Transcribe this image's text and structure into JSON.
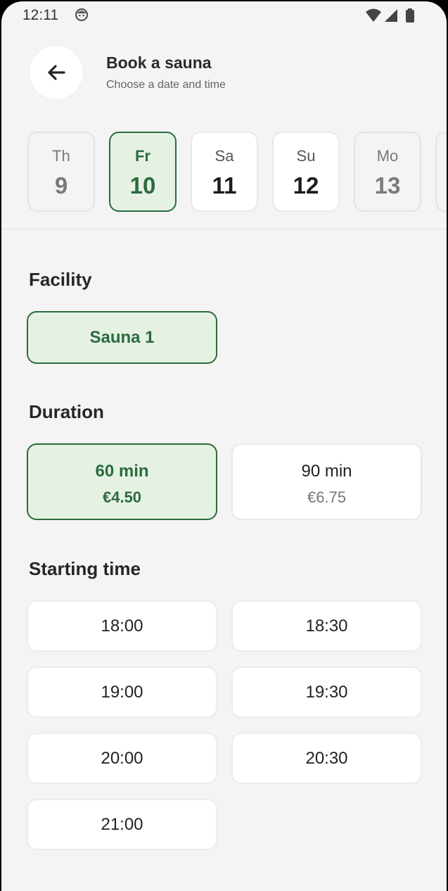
{
  "status_bar": {
    "time": "12:11"
  },
  "header": {
    "title": "Book a sauna",
    "subtitle": "Choose a date and time"
  },
  "dates": [
    {
      "dow": "Th",
      "day": "9",
      "state": "disabled"
    },
    {
      "dow": "Fr",
      "day": "10",
      "state": "selected"
    },
    {
      "dow": "Sa",
      "day": "11",
      "state": "available"
    },
    {
      "dow": "Su",
      "day": "12",
      "state": "available"
    },
    {
      "dow": "Mo",
      "day": "13",
      "state": "disabled"
    }
  ],
  "facility": {
    "title": "Facility",
    "options": [
      {
        "label": "Sauna 1",
        "selected": true
      }
    ]
  },
  "duration": {
    "title": "Duration",
    "options": [
      {
        "label": "60 min",
        "price": "€4.50",
        "selected": true
      },
      {
        "label": "90 min",
        "price": "€6.75",
        "selected": false
      }
    ]
  },
  "starting_time": {
    "title": "Starting time",
    "slots": [
      "18:00",
      "18:30",
      "19:00",
      "19:30",
      "20:00",
      "20:30",
      "21:00"
    ]
  },
  "colors": {
    "accent": "#2b6b3e",
    "accent_bg": "#e5f2e3",
    "background": "#f4f4f4"
  }
}
